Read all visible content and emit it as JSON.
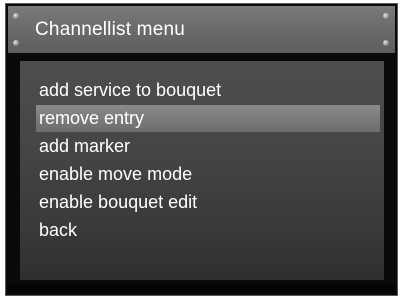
{
  "window": {
    "title": "Channellist menu"
  },
  "menu": {
    "selected_index": 1,
    "items": [
      {
        "label": "add service to bouquet"
      },
      {
        "label": "remove entry"
      },
      {
        "label": "add marker"
      },
      {
        "label": "enable move mode"
      },
      {
        "label": "enable bouquet edit"
      },
      {
        "label": "back"
      }
    ]
  },
  "colors": {
    "background": "#0a0a0a",
    "titlebar": "#6c6c6c",
    "content": "#454545",
    "highlight": "#7b7b7b",
    "text": "#ffffff"
  }
}
